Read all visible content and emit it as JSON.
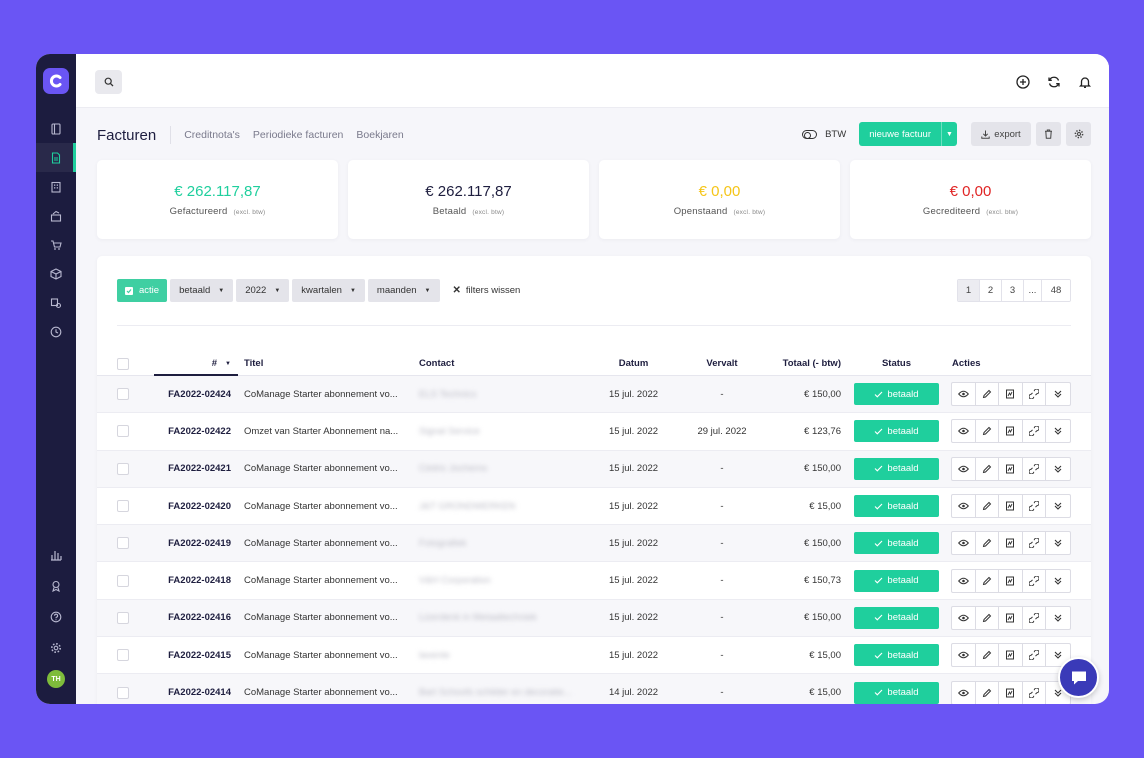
{
  "topbar": {
    "search_icon": "search-icon",
    "icons": [
      "add-circle-icon",
      "refresh-icon",
      "bell-icon"
    ]
  },
  "sidebar": {
    "logo": "C",
    "items": [
      "book-icon",
      "invoice-icon",
      "building-icon",
      "chart-up-icon",
      "cart-icon",
      "box-icon",
      "truck-icon",
      "clock-icon"
    ],
    "bottom_items": [
      "stats-icon",
      "team-icon",
      "help-icon",
      "settings-icon"
    ],
    "avatar_initials": "TH"
  },
  "header": {
    "title": "Facturen",
    "tabs": [
      "Creditnota's",
      "Periodieke facturen",
      "Boekjaren"
    ],
    "btw_label": "BTW",
    "new_invoice_label": "nieuwe factuur",
    "export_label": "export"
  },
  "cards": [
    {
      "amount": "€ 262.117,87",
      "label": "Gefactureerd",
      "note": "(excl. btw)",
      "color": "#1fcf9d"
    },
    {
      "amount": "€ 262.117,87",
      "label": "Betaald",
      "note": "(excl. btw)",
      "color": "#1e1e3f"
    },
    {
      "amount": "€ 0,00",
      "label": "Openstaand",
      "note": "(excl. btw)",
      "color": "#f5c518"
    },
    {
      "amount": "€ 0,00",
      "label": "Gecrediteerd",
      "note": "(excl. btw)",
      "color": "#e02424"
    }
  ],
  "filters": {
    "active_filter": "actie",
    "dropdowns": [
      "betaald",
      "2022",
      "kwartalen",
      "maanden"
    ],
    "clear_label": "filters wissen"
  },
  "pagination": {
    "pages": [
      "1",
      "2",
      "3",
      "...",
      "48"
    ],
    "current": "1"
  },
  "table": {
    "columns": {
      "num": "#",
      "title": "Titel",
      "contact": "Contact",
      "date": "Datum",
      "due": "Vervalt",
      "total": "Totaal (- btw)",
      "status": "Status",
      "actions": "Acties"
    },
    "rows": [
      {
        "num": "FA2022-02424",
        "title": "CoManage Starter abonnement vo...",
        "contact": "ELS Technics",
        "date": "15 jul. 2022",
        "due": "-",
        "total": "€ 150,00",
        "status": "betaald"
      },
      {
        "num": "FA2022-02422",
        "title": "Omzet van Starter Abonnement na...",
        "contact": "Signal Service",
        "date": "15 jul. 2022",
        "due": "29 jul. 2022",
        "total": "€ 123,76",
        "status": "betaald"
      },
      {
        "num": "FA2022-02421",
        "title": "CoManage Starter abonnement vo...",
        "contact": "Cédric Jochems",
        "date": "15 jul. 2022",
        "due": "-",
        "total": "€ 150,00",
        "status": "betaald"
      },
      {
        "num": "FA2022-02420",
        "title": "CoManage Starter abonnement vo...",
        "contact": "J&T GRONDWERKEN",
        "date": "15 jul. 2022",
        "due": "-",
        "total": "€ 15,00",
        "status": "betaald"
      },
      {
        "num": "FA2022-02419",
        "title": "CoManage Starter abonnement vo...",
        "contact": "Fotografiek",
        "date": "15 jul. 2022",
        "due": "-",
        "total": "€ 150,00",
        "status": "betaald"
      },
      {
        "num": "FA2022-02418",
        "title": "CoManage Starter abonnement vo...",
        "contact": "V&H Corporation",
        "date": "15 jul. 2022",
        "due": "-",
        "total": "€ 150,73",
        "status": "betaald"
      },
      {
        "num": "FA2022-02416",
        "title": "CoManage Starter abonnement vo...",
        "contact": "Lizerdenk in Metaaltechniek",
        "date": "15 jul. 2022",
        "due": "-",
        "total": "€ 150,00",
        "status": "betaald"
      },
      {
        "num": "FA2022-02415",
        "title": "CoManage Starter abonnement vo...",
        "contact": "lavente",
        "date": "15 jul. 2022",
        "due": "-",
        "total": "€ 15,00",
        "status": "betaald"
      },
      {
        "num": "FA2022-02414",
        "title": "CoManage Starter abonnement vo...",
        "contact": "Bart Schoofs schilder en decoratie...",
        "date": "14 jul. 2022",
        "due": "-",
        "total": "€ 15,00",
        "status": "betaald"
      }
    ],
    "row_actions": [
      "eye-icon",
      "pencil-icon",
      "pdf-icon",
      "link-icon",
      "chevron-double-down-icon"
    ]
  },
  "colors": {
    "accent": "#1fcf9d",
    "sidebar": "#1c1c3f",
    "background": "#6a55f4"
  }
}
